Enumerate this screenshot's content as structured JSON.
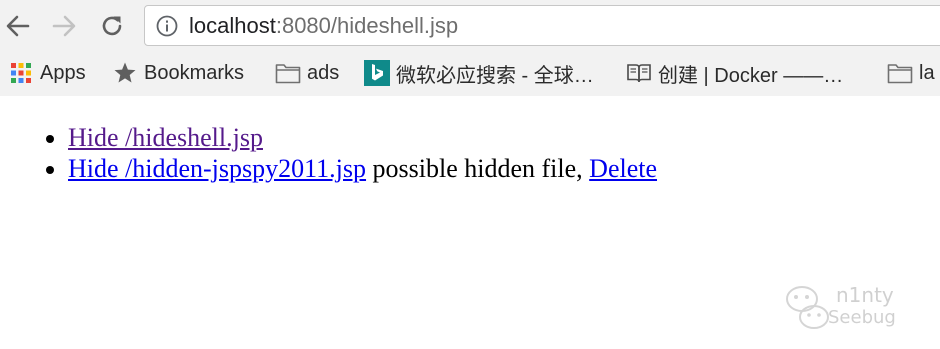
{
  "browser": {
    "nav": {
      "back_icon": "arrow-left-icon",
      "forward_icon": "arrow-right-icon",
      "reload_icon": "reload-icon"
    },
    "address": {
      "host": "localhost",
      "rest": ":8080/hideshell.jsp",
      "icon": "info-icon"
    },
    "bookmarks": [
      {
        "label": "Apps",
        "icon": "apps-grid-icon"
      },
      {
        "label": "Bookmarks",
        "icon": "star-icon"
      },
      {
        "label": "ads",
        "icon": "folder-icon"
      },
      {
        "label": "微软必应搜索 - 全球…",
        "icon": "bing-icon"
      },
      {
        "label": "创建 | Docker ——…",
        "icon": "book-icon"
      },
      {
        "label": "la",
        "icon": "folder-icon"
      }
    ]
  },
  "page": {
    "items": [
      {
        "link_text": "Hide /hideshell.jsp",
        "state": "visited"
      },
      {
        "link_text": "Hide /hidden-jspspy2011.jsp",
        "state": "unvisited",
        "middle_text": " possible hidden file, ",
        "action_text": "Delete"
      }
    ]
  },
  "watermark": {
    "line1": "n1nty",
    "line2": "Seebug"
  },
  "colors": {
    "visited_link": "#551a8b",
    "link": "#0000ee",
    "chrome_bg": "#f2f2f2"
  }
}
